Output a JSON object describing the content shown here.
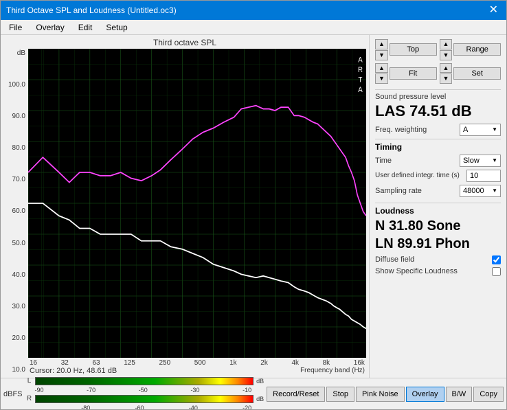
{
  "window": {
    "title": "Third Octave SPL and Loudness (Untitled.oc3)"
  },
  "menu": {
    "items": [
      "File",
      "Overlay",
      "Edit",
      "Setup"
    ]
  },
  "chart": {
    "title": "Third octave SPL",
    "y_axis_title": "dB",
    "y_labels": [
      "100.0",
      "90.0",
      "80.0",
      "70.0",
      "60.0",
      "50.0",
      "40.0",
      "30.0",
      "20.0",
      "10.0"
    ],
    "x_labels": [
      "16",
      "32",
      "63",
      "125",
      "250",
      "500",
      "1k",
      "2k",
      "4k",
      "8k",
      "16k"
    ],
    "cursor_text": "Cursor:  20.0 Hz, 48.61 dB",
    "freq_band_label": "Frequency band (Hz)",
    "arta_label": "A\nR\nT\nA"
  },
  "nav_controls": {
    "top_label": "Top",
    "fit_label": "Fit",
    "range_label": "Range",
    "set_label": "Set"
  },
  "spl": {
    "section_label": "Sound pressure level",
    "value": "LAS 74.51 dB",
    "freq_weighting_label": "Freq. weighting",
    "freq_weighting_value": "A"
  },
  "timing": {
    "title": "Timing",
    "time_label": "Time",
    "time_value": "Slow",
    "integr_label": "User defined integr. time (s)",
    "integr_value": "10",
    "sampling_label": "Sampling rate",
    "sampling_value": "48000"
  },
  "loudness": {
    "title": "Loudness",
    "n_value": "N 31.80 Sone",
    "ln_value": "LN 89.91 Phon",
    "diffuse_field_label": "Diffuse field",
    "show_specific_label": "Show Specific Loudness"
  },
  "bottom": {
    "dbfs_label": "dBFS",
    "meter_labels_l": [
      "-90",
      "-70",
      "-50",
      "-30",
      "-10"
    ],
    "meter_labels_r": [
      "-80",
      "-60",
      "-40",
      "-20"
    ],
    "channel_l": "L",
    "channel_r": "R",
    "db_label": "dB",
    "buttons": [
      "Record/Reset",
      "Stop",
      "Pink Noise",
      "Overlay",
      "B/W",
      "Copy"
    ]
  }
}
